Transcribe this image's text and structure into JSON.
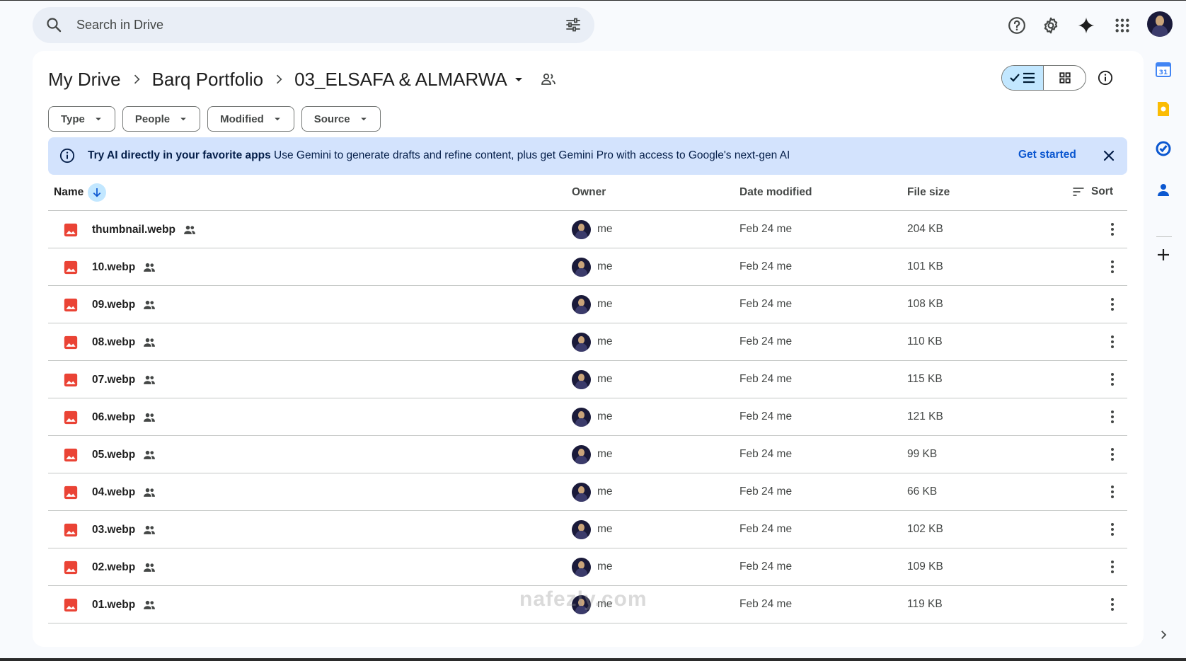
{
  "search": {
    "placeholder": "Search in Drive"
  },
  "top_icons": [
    "help-icon",
    "settings-icon",
    "gemini-sparkle-icon",
    "apps-grid-icon"
  ],
  "breadcrumb": {
    "items": [
      "My Drive",
      "Barq Portfolio"
    ],
    "current": "03_ELSAFA & ALMARWA"
  },
  "filters": [
    "Type",
    "People",
    "Modified",
    "Source"
  ],
  "banner": {
    "title": "Try AI directly in your favorite apps",
    "text": "Use Gemini to generate drafts and refine content, plus get Gemini Pro with access to Google's next-gen AI",
    "cta": "Get started"
  },
  "table": {
    "headers": {
      "name": "Name",
      "owner": "Owner",
      "date": "Date modified",
      "size": "File size",
      "sort": "Sort"
    },
    "rows": [
      {
        "name": "thumbnail.webp",
        "owner": "me",
        "date": "Feb 24 me",
        "size": "204 KB"
      },
      {
        "name": "10.webp",
        "owner": "me",
        "date": "Feb 24 me",
        "size": "101 KB"
      },
      {
        "name": "09.webp",
        "owner": "me",
        "date": "Feb 24 me",
        "size": "108 KB"
      },
      {
        "name": "08.webp",
        "owner": "me",
        "date": "Feb 24 me",
        "size": "110 KB"
      },
      {
        "name": "07.webp",
        "owner": "me",
        "date": "Feb 24 me",
        "size": "115 KB"
      },
      {
        "name": "06.webp",
        "owner": "me",
        "date": "Feb 24 me",
        "size": "121 KB"
      },
      {
        "name": "05.webp",
        "owner": "me",
        "date": "Feb 24 me",
        "size": "99 KB"
      },
      {
        "name": "04.webp",
        "owner": "me",
        "date": "Feb 24 me",
        "size": "66 KB"
      },
      {
        "name": "03.webp",
        "owner": "me",
        "date": "Feb 24 me",
        "size": "102 KB"
      },
      {
        "name": "02.webp",
        "owner": "me",
        "date": "Feb 24 me",
        "size": "109 KB"
      },
      {
        "name": "01.webp",
        "owner": "me",
        "date": "Feb 24 me",
        "size": "119 KB"
      }
    ]
  },
  "side_rail": [
    "calendar-icon",
    "keep-icon",
    "tasks-icon",
    "contacts-icon"
  ],
  "watermark": "nafezly.com",
  "colors": {
    "accent": "#0b57d0",
    "selected": "#c2e7ff",
    "banner": "#d3e3fd",
    "file_icon": "#ea4335"
  }
}
